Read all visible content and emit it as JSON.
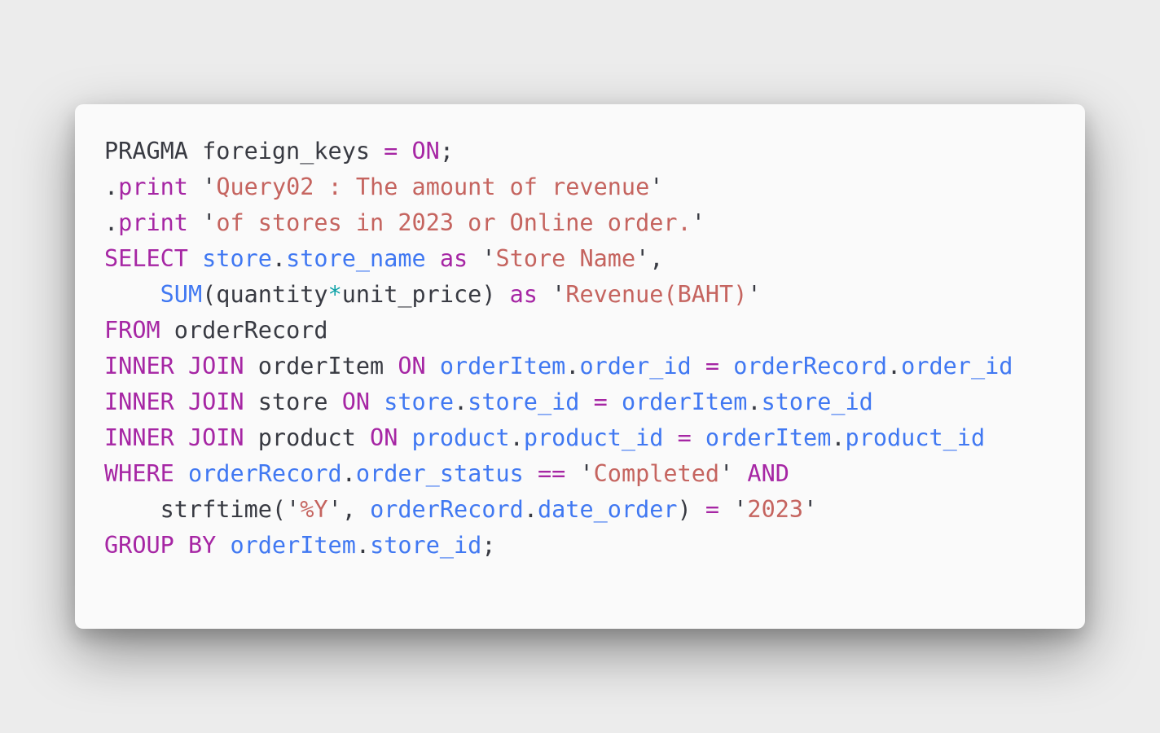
{
  "colors": {
    "background": "#ececec",
    "card": "#fafafa",
    "keyword": "#a626a4",
    "identifier": "#4078f2",
    "string": "#c5645f",
    "plain": "#383a42",
    "operator": "#0ca1a6"
  },
  "code": {
    "lines": [
      {
        "tokens": [
          {
            "t": "pl",
            "v": "PRAGMA foreign_keys "
          },
          {
            "t": "kw",
            "v": "="
          },
          {
            "t": "pl",
            "v": " "
          },
          {
            "t": "kw",
            "v": "ON"
          },
          {
            "t": "pl",
            "v": ";"
          }
        ]
      },
      {
        "tokens": [
          {
            "t": "pl",
            "v": "."
          },
          {
            "t": "kw",
            "v": "print"
          },
          {
            "t": "pl",
            "v": " "
          },
          {
            "t": "q",
            "v": "'"
          },
          {
            "t": "str",
            "v": "Query02 : The amount of revenue"
          },
          {
            "t": "q",
            "v": "'"
          }
        ]
      },
      {
        "tokens": [
          {
            "t": "pl",
            "v": "."
          },
          {
            "t": "kw",
            "v": "print"
          },
          {
            "t": "pl",
            "v": " "
          },
          {
            "t": "q",
            "v": "'"
          },
          {
            "t": "str",
            "v": "of stores in 2023 or Online order."
          },
          {
            "t": "q",
            "v": "'"
          }
        ]
      },
      {
        "tokens": [
          {
            "t": "kw",
            "v": "SELECT"
          },
          {
            "t": "pl",
            "v": " "
          },
          {
            "t": "id",
            "v": "store"
          },
          {
            "t": "pl",
            "v": "."
          },
          {
            "t": "id",
            "v": "store_name"
          },
          {
            "t": "pl",
            "v": " "
          },
          {
            "t": "kw",
            "v": "as"
          },
          {
            "t": "pl",
            "v": " "
          },
          {
            "t": "q",
            "v": "'"
          },
          {
            "t": "str",
            "v": "Store Name"
          },
          {
            "t": "q",
            "v": "'"
          },
          {
            "t": "pl",
            "v": ","
          }
        ]
      },
      {
        "tokens": [
          {
            "t": "pl",
            "v": "    "
          },
          {
            "t": "id",
            "v": "SUM"
          },
          {
            "t": "pl",
            "v": "(quantity"
          },
          {
            "t": "op",
            "v": "*"
          },
          {
            "t": "pl",
            "v": "unit_price) "
          },
          {
            "t": "kw",
            "v": "as"
          },
          {
            "t": "pl",
            "v": " "
          },
          {
            "t": "q",
            "v": "'"
          },
          {
            "t": "str",
            "v": "Revenue(BAHT)"
          },
          {
            "t": "q",
            "v": "'"
          }
        ]
      },
      {
        "tokens": [
          {
            "t": "kw",
            "v": "FROM"
          },
          {
            "t": "pl",
            "v": " orderRecord"
          }
        ]
      },
      {
        "tokens": [
          {
            "t": "kw",
            "v": "INNER JOIN"
          },
          {
            "t": "pl",
            "v": " orderItem "
          },
          {
            "t": "kw",
            "v": "ON"
          },
          {
            "t": "pl",
            "v": " "
          },
          {
            "t": "id",
            "v": "orderItem"
          },
          {
            "t": "pl",
            "v": "."
          },
          {
            "t": "id",
            "v": "order_id"
          },
          {
            "t": "pl",
            "v": " "
          },
          {
            "t": "kw",
            "v": "="
          },
          {
            "t": "pl",
            "v": " "
          },
          {
            "t": "id",
            "v": "orderRecord"
          },
          {
            "t": "pl",
            "v": "."
          },
          {
            "t": "id",
            "v": "order_id"
          }
        ]
      },
      {
        "tokens": [
          {
            "t": "kw",
            "v": "INNER JOIN"
          },
          {
            "t": "pl",
            "v": " store "
          },
          {
            "t": "kw",
            "v": "ON"
          },
          {
            "t": "pl",
            "v": " "
          },
          {
            "t": "id",
            "v": "store"
          },
          {
            "t": "pl",
            "v": "."
          },
          {
            "t": "id",
            "v": "store_id"
          },
          {
            "t": "pl",
            "v": " "
          },
          {
            "t": "kw",
            "v": "="
          },
          {
            "t": "pl",
            "v": " "
          },
          {
            "t": "id",
            "v": "orderItem"
          },
          {
            "t": "pl",
            "v": "."
          },
          {
            "t": "id",
            "v": "store_id"
          }
        ]
      },
      {
        "tokens": [
          {
            "t": "kw",
            "v": "INNER JOIN"
          },
          {
            "t": "pl",
            "v": " product "
          },
          {
            "t": "kw",
            "v": "ON"
          },
          {
            "t": "pl",
            "v": " "
          },
          {
            "t": "id",
            "v": "product"
          },
          {
            "t": "pl",
            "v": "."
          },
          {
            "t": "id",
            "v": "product_id"
          },
          {
            "t": "pl",
            "v": " "
          },
          {
            "t": "kw",
            "v": "="
          },
          {
            "t": "pl",
            "v": " "
          },
          {
            "t": "id",
            "v": "orderItem"
          },
          {
            "t": "pl",
            "v": "."
          },
          {
            "t": "id",
            "v": "product_id"
          }
        ]
      },
      {
        "tokens": [
          {
            "t": "kw",
            "v": "WHERE"
          },
          {
            "t": "pl",
            "v": " "
          },
          {
            "t": "id",
            "v": "orderRecord"
          },
          {
            "t": "pl",
            "v": "."
          },
          {
            "t": "id",
            "v": "order_status"
          },
          {
            "t": "pl",
            "v": " "
          },
          {
            "t": "kw",
            "v": "=="
          },
          {
            "t": "pl",
            "v": " "
          },
          {
            "t": "q",
            "v": "'"
          },
          {
            "t": "str",
            "v": "Completed"
          },
          {
            "t": "q",
            "v": "'"
          },
          {
            "t": "pl",
            "v": " "
          },
          {
            "t": "kw",
            "v": "AND"
          }
        ]
      },
      {
        "tokens": [
          {
            "t": "pl",
            "v": "    strftime("
          },
          {
            "t": "q",
            "v": "'"
          },
          {
            "t": "str",
            "v": "%Y"
          },
          {
            "t": "q",
            "v": "'"
          },
          {
            "t": "pl",
            "v": ", "
          },
          {
            "t": "id",
            "v": "orderRecord"
          },
          {
            "t": "pl",
            "v": "."
          },
          {
            "t": "id",
            "v": "date_order"
          },
          {
            "t": "pl",
            "v": ") "
          },
          {
            "t": "kw",
            "v": "="
          },
          {
            "t": "pl",
            "v": " "
          },
          {
            "t": "q",
            "v": "'"
          },
          {
            "t": "str",
            "v": "2023"
          },
          {
            "t": "q",
            "v": "'"
          }
        ]
      },
      {
        "tokens": [
          {
            "t": "kw",
            "v": "GROUP BY"
          },
          {
            "t": "pl",
            "v": " "
          },
          {
            "t": "id",
            "v": "orderItem"
          },
          {
            "t": "pl",
            "v": "."
          },
          {
            "t": "id",
            "v": "store_id"
          },
          {
            "t": "pl",
            "v": ";"
          }
        ]
      }
    ]
  }
}
